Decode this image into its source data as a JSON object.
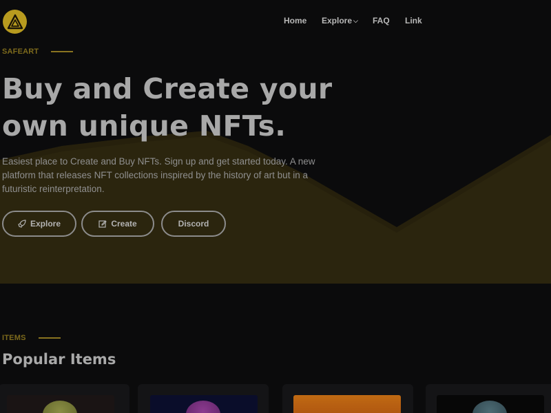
{
  "header": {
    "logo_icon": "triangle-logo-icon",
    "nav": {
      "home": "Home",
      "explore": "Explore",
      "faq": "FAQ",
      "link": "Link"
    }
  },
  "hero": {
    "eyebrow": "SAFEART",
    "title_line1": "Buy and Create your",
    "title_line2": "own unique NFTs.",
    "description": "Easiest place to Create and Buy NFTs. Sign up and get started today. A new platform that releases NFT collections inspired by the history of art but in a futuristic reinterpretation.",
    "buttons": {
      "explore": "Explore",
      "create": "Create",
      "discord": "Discord"
    }
  },
  "items": {
    "eyebrow": "ITEMS",
    "title": "Popular Items"
  },
  "colors": {
    "background": "#0b0b0c",
    "accent_gold": "#b89b1f",
    "hero_band": "#2b250e"
  }
}
